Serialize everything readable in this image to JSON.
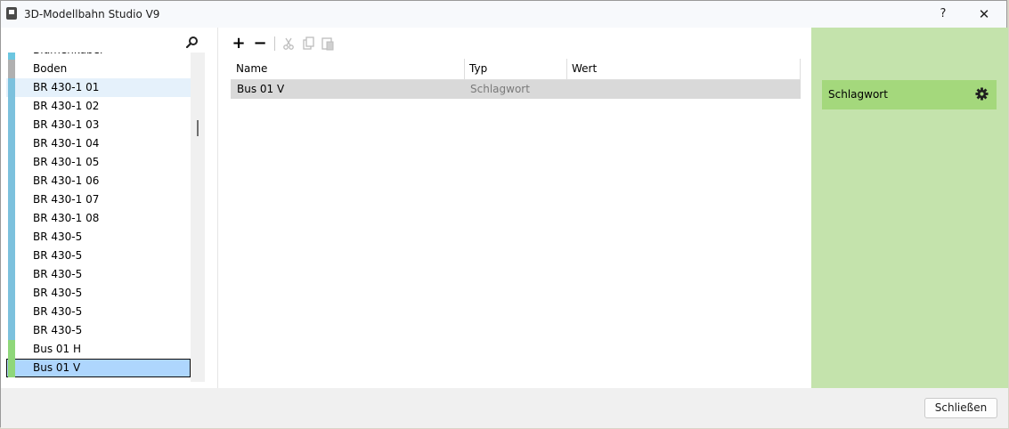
{
  "window": {
    "title": "3D-Modellbahn Studio V9",
    "help_label": "?",
    "close_label": "✕"
  },
  "left_list": {
    "search_icon": "search-icon",
    "items": [
      {
        "label": "Blumenkübel",
        "marker": "#6cc6e0",
        "partial": true,
        "chevron": true
      },
      {
        "label": "Boden",
        "marker": "#b0b0b0"
      },
      {
        "label": "BR 430-1 01",
        "marker": "#7cc1dd",
        "hl": true
      },
      {
        "label": "BR 430-1 02",
        "marker": "#7cc1dd"
      },
      {
        "label": "BR 430-1 03",
        "marker": "#7cc1dd"
      },
      {
        "label": "BR 430-1 04",
        "marker": "#7cc1dd"
      },
      {
        "label": "BR 430-1 05",
        "marker": "#7cc1dd"
      },
      {
        "label": "BR 430-1 06",
        "marker": "#7cc1dd"
      },
      {
        "label": "BR 430-1 07",
        "marker": "#7cc1dd"
      },
      {
        "label": "BR 430-1 08",
        "marker": "#7cc1dd"
      },
      {
        "label": "BR 430-5",
        "marker": "#7cc1dd"
      },
      {
        "label": "BR 430-5",
        "marker": "#7cc1dd"
      },
      {
        "label": "BR 430-5",
        "marker": "#7cc1dd"
      },
      {
        "label": "BR 430-5",
        "marker": "#7cc1dd"
      },
      {
        "label": "BR 430-5",
        "marker": "#7cc1dd"
      },
      {
        "label": "BR 430-5",
        "marker": "#7cc1dd"
      },
      {
        "label": "Bus 01 H",
        "marker": "#8fd77a"
      },
      {
        "label": "Bus 01 V",
        "marker": "#8fd77a",
        "selected": true
      }
    ]
  },
  "toolbar": {
    "add": "+",
    "remove": "−",
    "cut_icon": "cut-icon",
    "copy_icon": "copy-icon",
    "paste_icon": "paste-icon"
  },
  "grid": {
    "headers": {
      "name": "Name",
      "typ": "Typ",
      "wert": "Wert"
    },
    "rows": [
      {
        "name": "Bus 01 V",
        "typ": "Schlagwort",
        "wert": ""
      }
    ]
  },
  "properties": {
    "label": "Schlagwort",
    "icon": "gear-icon",
    "accent": "#a4d87c",
    "background": "#c4e3ac"
  },
  "footer": {
    "close_button": "Schließen"
  }
}
